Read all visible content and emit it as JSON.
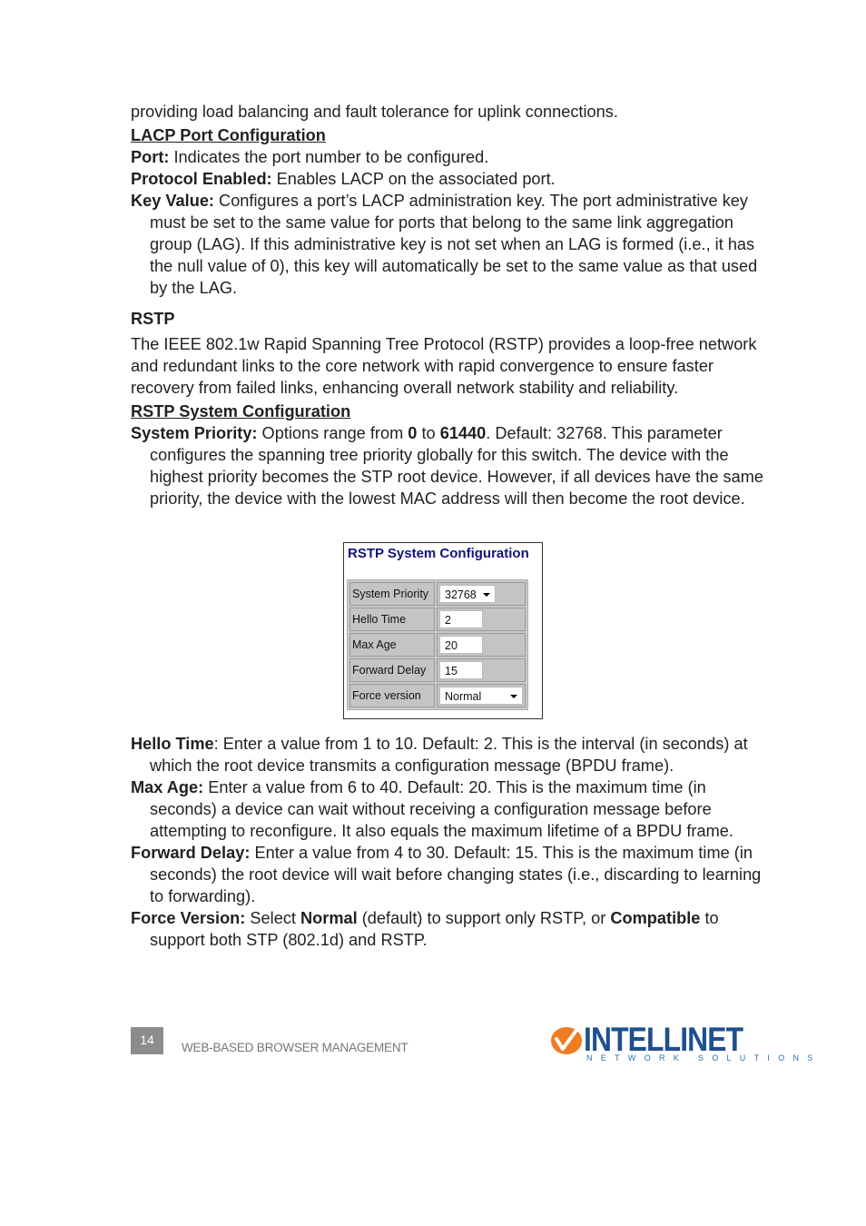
{
  "body": {
    "intro_line": "providing load balancing and fault tolerance for uplink connections.",
    "lacp_heading": "LACP Port Configuration",
    "lacp_items": [
      {
        "term": "Port:",
        "text": " Indicates the port number to be configured."
      },
      {
        "term": "Protocol Enabled:",
        "text": " Enables LACP on the associated port."
      },
      {
        "term": "Key Value:",
        "text": " Configures a port’s LACP administration key. The port administrative key must be set to the same value for ports that belong to the same link aggregation group (LAG). If this administrative key is not set when an LAG is formed (i.e., it has the null value of 0), this key will automatically be set to the same value as that used by the LAG."
      }
    ],
    "rstp_heading": "RSTP",
    "rstp_paragraph": "The IEEE 802.1w Rapid Spanning Tree Protocol (RSTP) provides a loop-free network and redundant links to the core network with rapid convergence to ensure faster recovery from failed links, enhancing overall network stability and reliability.",
    "rstp_sys_heading": "RSTP System Configuration",
    "system_priority": {
      "term": "System Priority:",
      "t1": " Options range from ",
      "b1": "0",
      "t2": " to ",
      "b2": "61440",
      "t3": ". Default: 32768. This parameter configures the spanning tree priority globally for this switch. The device with the highest priority becomes the STP root device. However, if all devices have the same priority, the device with the lowest MAC address will then become the root device."
    },
    "after_items": [
      {
        "term": "Hello Time",
        "text": ": Enter a value from 1 to 10. Default: 2. This is the interval (in seconds) at which the root device transmits a configuration message (BPDU frame)."
      },
      {
        "term": "Max Age:",
        "text": " Enter a value from 6 to 40. Default: 20. This is the maximum time (in seconds) a device can wait without receiving a configuration message before attempting to reconfigure. It also equals the maximum lifetime of a BPDU frame."
      },
      {
        "term": "Forward Delay:",
        "text": " Enter a value from 4 to 30. Default: 15. This is the maximum time (in seconds) the root device will wait before changing states (i.e., discarding to learning to forwarding)."
      }
    ],
    "force_version": {
      "term": "Force Version:",
      "t1": " Select ",
      "b1": "Normal",
      "t2": " (default) to support only RSTP, or ",
      "b2": "Compatible",
      "t3": " to support both STP (802.1d) and RSTP."
    }
  },
  "screenshot": {
    "title": "RSTP System Configuration",
    "title_color": "#10137a",
    "rows": [
      {
        "label": "System Priority",
        "value": "32768",
        "type": "select"
      },
      {
        "label": "Hello Time",
        "value": "2",
        "type": "input"
      },
      {
        "label": "Max Age",
        "value": "20",
        "type": "input"
      },
      {
        "label": "Forward Delay",
        "value": "15",
        "type": "input"
      },
      {
        "label": "Force version",
        "value": "Normal",
        "type": "select"
      }
    ]
  },
  "footer": {
    "page_number": "14",
    "section": "WEB-BASED BROWSER MANAGEMENT",
    "logo_word": "INTELLINET",
    "logo_sub": "NETWORK SOLUTIONS",
    "logo_orange": "#f07c22",
    "logo_blue": "#1e4f8e"
  }
}
